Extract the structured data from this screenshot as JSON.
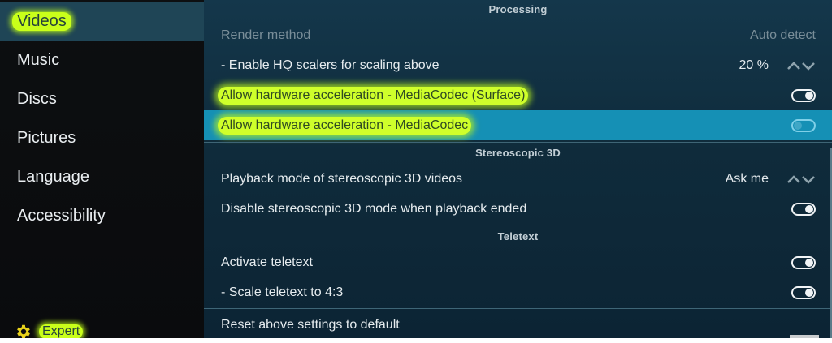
{
  "sidebar": {
    "items": [
      {
        "label": "Videos",
        "active": true
      },
      {
        "label": "Music"
      },
      {
        "label": "Discs"
      },
      {
        "label": "Pictures"
      },
      {
        "label": "Language"
      },
      {
        "label": "Accessibility"
      }
    ],
    "level_label": "Expert",
    "level_icon": "gear-icon"
  },
  "sections": {
    "processing": "Processing",
    "stereoscopic": "Stereoscopic 3D",
    "teletext": "Teletext"
  },
  "settings": {
    "render_method": {
      "label": "Render method",
      "value": "Auto detect",
      "disabled": true
    },
    "hq_scalers": {
      "label": "- Enable HQ scalers for scaling above",
      "value": "20 %"
    },
    "hw_surface": {
      "label": "Allow hardware acceleration - MediaCodec (Surface)",
      "enabled": true
    },
    "hw_mediacodec": {
      "label": "Allow hardware acceleration - MediaCodec",
      "enabled": false,
      "selected": true
    },
    "stereo_playback_mode": {
      "label": "Playback mode of stereoscopic 3D videos",
      "value": "Ask me"
    },
    "stereo_disable": {
      "label": "Disable stereoscopic 3D mode when playback ended",
      "enabled": true
    },
    "teletext_activate": {
      "label": "Activate teletext",
      "enabled": true
    },
    "teletext_scale": {
      "label": "- Scale teletext to 4:3",
      "enabled": true
    },
    "reset": {
      "label": "Reset above settings to default"
    }
  },
  "colors": {
    "accent_highlight": "#c9ff1a",
    "selected_row": "#1590b5",
    "active_sidebar": "#1f4556"
  }
}
